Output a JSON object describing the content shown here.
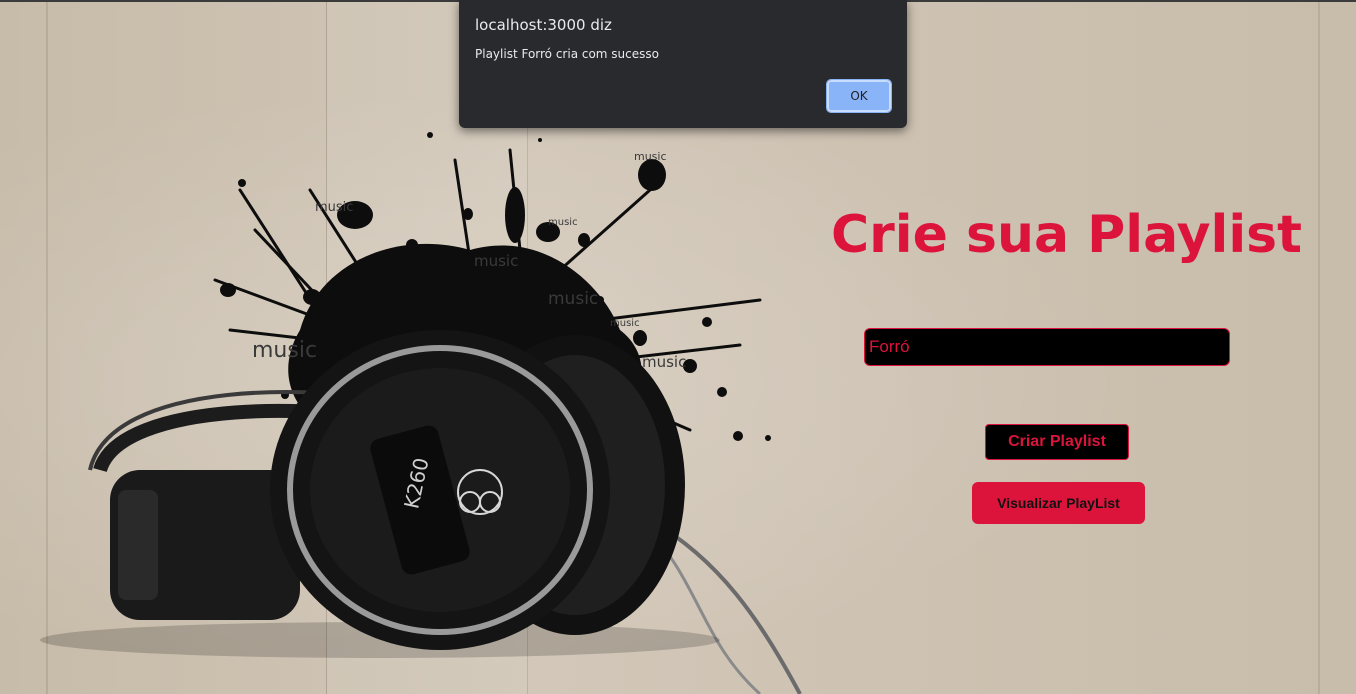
{
  "page": {
    "title": "Crie sua Playlist",
    "accent_color": "#dc143c"
  },
  "form": {
    "playlist_name_value": "Forró",
    "create_button_label": "Criar Playlist",
    "view_button_label": "Visualizar PlayList"
  },
  "background_image": {
    "model_label": "K260",
    "splash_words": [
      "music",
      "music",
      "music",
      "music",
      "music",
      "music",
      "music",
      "music"
    ]
  },
  "alert_dialog": {
    "origin": "localhost:3000 diz",
    "message": "Playlist Forró cria com sucesso",
    "ok_label": "OK"
  }
}
